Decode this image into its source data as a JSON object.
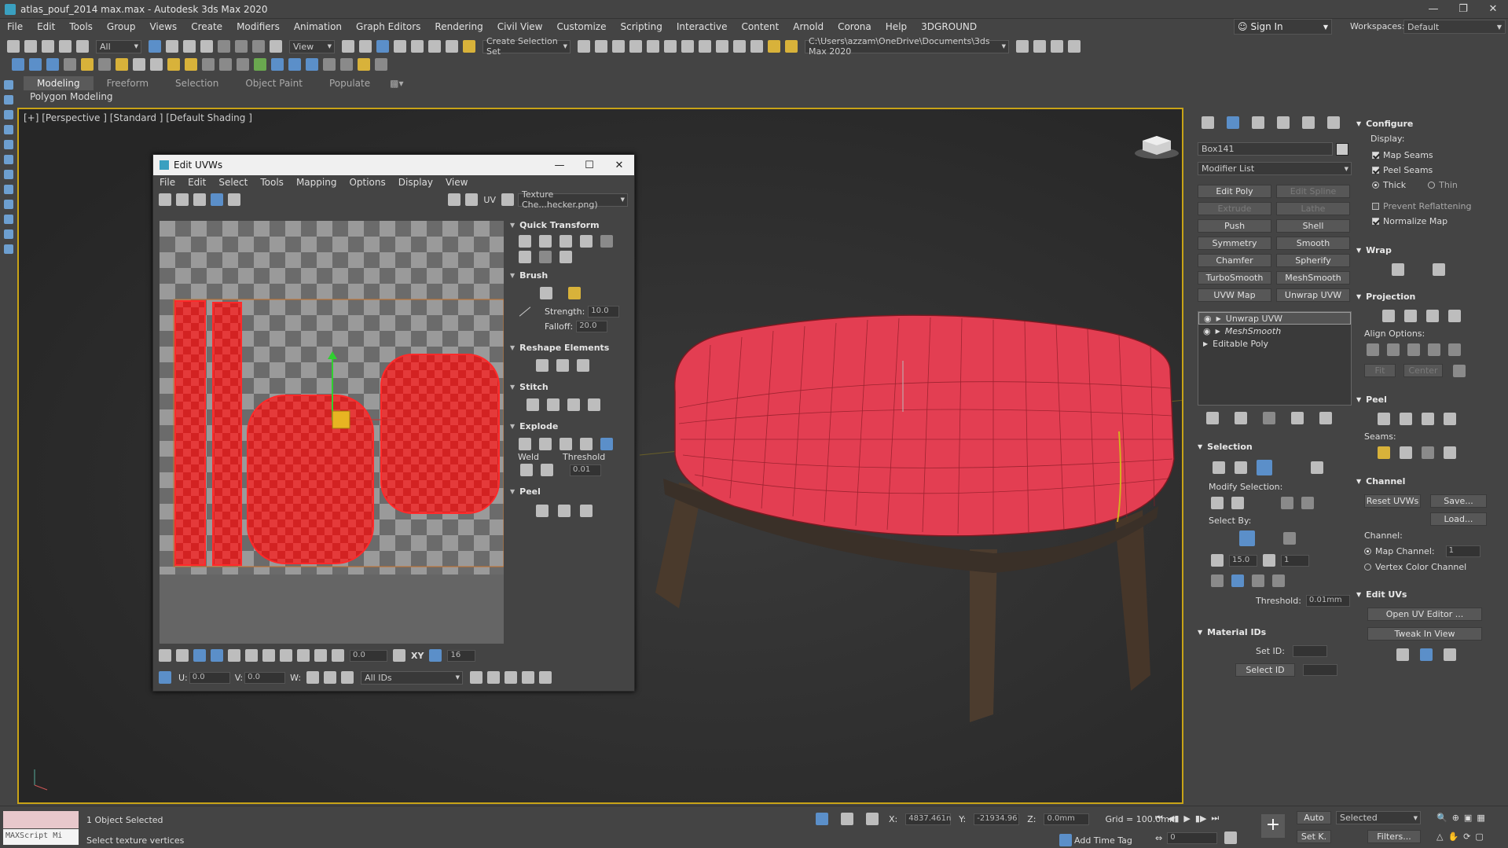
{
  "window": {
    "title": "atlas_pouf_2014 max.max - Autodesk 3ds Max 2020"
  },
  "menu": [
    "File",
    "Edit",
    "Tools",
    "Group",
    "Views",
    "Create",
    "Modifiers",
    "Animation",
    "Graph Editors",
    "Rendering",
    "Civil View",
    "Customize",
    "Scripting",
    "Interactive",
    "Content",
    "Arnold",
    "Corona",
    "Help",
    "3DGROUND"
  ],
  "account": {
    "sign_in": "Sign In",
    "workspaces_label": "Workspaces:",
    "workspace_value": "Default"
  },
  "toolbar": {
    "filter_value": "All",
    "ref_coord": "View",
    "selection_set": "Create Selection Set",
    "project_path": "C:\\Users\\azzam\\OneDrive\\Documents\\3ds Max 2020"
  },
  "ribbon": {
    "tabs": [
      "Modeling",
      "Freeform",
      "Selection",
      "Object Paint",
      "Populate"
    ],
    "subtitle": "Polygon Modeling"
  },
  "viewport": {
    "label": "[+] [Perspective ] [Standard ] [Default Shading ]"
  },
  "uv_editor": {
    "title": "Edit UVWs",
    "menu": [
      "File",
      "Edit",
      "Select",
      "Tools",
      "Mapping",
      "Options",
      "Display",
      "View"
    ],
    "uv_label": "UV",
    "texture_dropdown": "Texture Che...hecker.png)",
    "rollouts": {
      "quick_transform": "Quick Transform",
      "brush": "Brush",
      "strength_label": "Strength:",
      "strength_value": "10.0",
      "falloff_label": "Falloff:",
      "falloff_value": "20.0",
      "reshape": "Reshape Elements",
      "stitch": "Stitch",
      "explode": "Explode",
      "weld": "Weld",
      "threshold_label": "Threshold",
      "threshold_value": "0.01",
      "peel": "Peel"
    },
    "bottom": {
      "angle_value": "0.0",
      "grid_value": "16",
      "xy_label": "XY",
      "u_label": "U:",
      "u_value": "0.0",
      "v_label": "V:",
      "v_value": "0.0",
      "w_label": "W:",
      "ids_value": "All IDs"
    }
  },
  "command_panel": {
    "object_name": "Box141",
    "modifier_list": "Modifier List",
    "modifier_buttons": [
      {
        "label": "Edit Poly",
        "enabled": true
      },
      {
        "label": "Edit Spline",
        "enabled": false
      },
      {
        "label": "Extrude",
        "enabled": false
      },
      {
        "label": "Lathe",
        "enabled": false
      },
      {
        "label": "Push",
        "enabled": true
      },
      {
        "label": "Shell",
        "enabled": true
      },
      {
        "label": "Symmetry",
        "enabled": true
      },
      {
        "label": "Smooth",
        "enabled": true
      },
      {
        "label": "Chamfer",
        "enabled": true
      },
      {
        "label": "Spherify",
        "enabled": true
      },
      {
        "label": "TurboSmooth",
        "enabled": true
      },
      {
        "label": "MeshSmooth",
        "enabled": true
      },
      {
        "label": "UVW Map",
        "enabled": true
      },
      {
        "label": "Unwrap UVW",
        "enabled": true
      }
    ],
    "stack": [
      "Unwrap UVW",
      "MeshSmooth",
      "Editable Poly"
    ],
    "selection": {
      "header": "Selection",
      "modify_selection": "Modify Selection:",
      "select_by": "Select By:",
      "angle_value": "15.0",
      "count_value": "1",
      "threshold_label": "Threshold:",
      "threshold_value": "0.01mm"
    },
    "material_ids": {
      "header": "Material IDs",
      "set_id": "Set ID:",
      "select_id": "Select ID"
    },
    "configure": {
      "header": "Configure",
      "display": "Display:",
      "map_seams": "Map Seams",
      "peel_seams": "Peel Seams",
      "thick": "Thick",
      "thin": "Thin",
      "prevent_reflattening": "Prevent Reflattening",
      "normalize_map": "Normalize Map"
    },
    "wrap": {
      "header": "Wrap"
    },
    "projection": {
      "header": "Projection",
      "align_options": "Align Options:",
      "fit": "Fit",
      "center": "Center"
    },
    "peel": {
      "header": "Peel",
      "seams": "Seams:"
    },
    "channel": {
      "header": "Channel",
      "reset_uvws": "Reset UVWs",
      "save": "Save...",
      "load": "Load...",
      "channel_label": "Channel:",
      "map_channel": "Map Channel:",
      "map_channel_value": "1",
      "vertex_color_channel": "Vertex Color Channel"
    },
    "edit_uvs": {
      "header": "Edit UVs",
      "open_uv_editor": "Open UV Editor ...",
      "tweak_in_view": "Tweak In View"
    }
  },
  "status": {
    "objects_selected": "1 Object Selected",
    "prompt": "Select texture vertices",
    "maxscript": "MAXScript Mi",
    "x_label": "X:",
    "x_value": "4837.461n",
    "y_label": "Y:",
    "y_value": "-21934.96",
    "z_label": "Z:",
    "z_value": "0.0mm",
    "grid": "Grid = 100.0mm",
    "add_time_tag": "Add Time Tag",
    "auto": "Auto",
    "set_k": "Set K.",
    "selected": "Selected",
    "filters": "Filters...",
    "frame": "0"
  }
}
